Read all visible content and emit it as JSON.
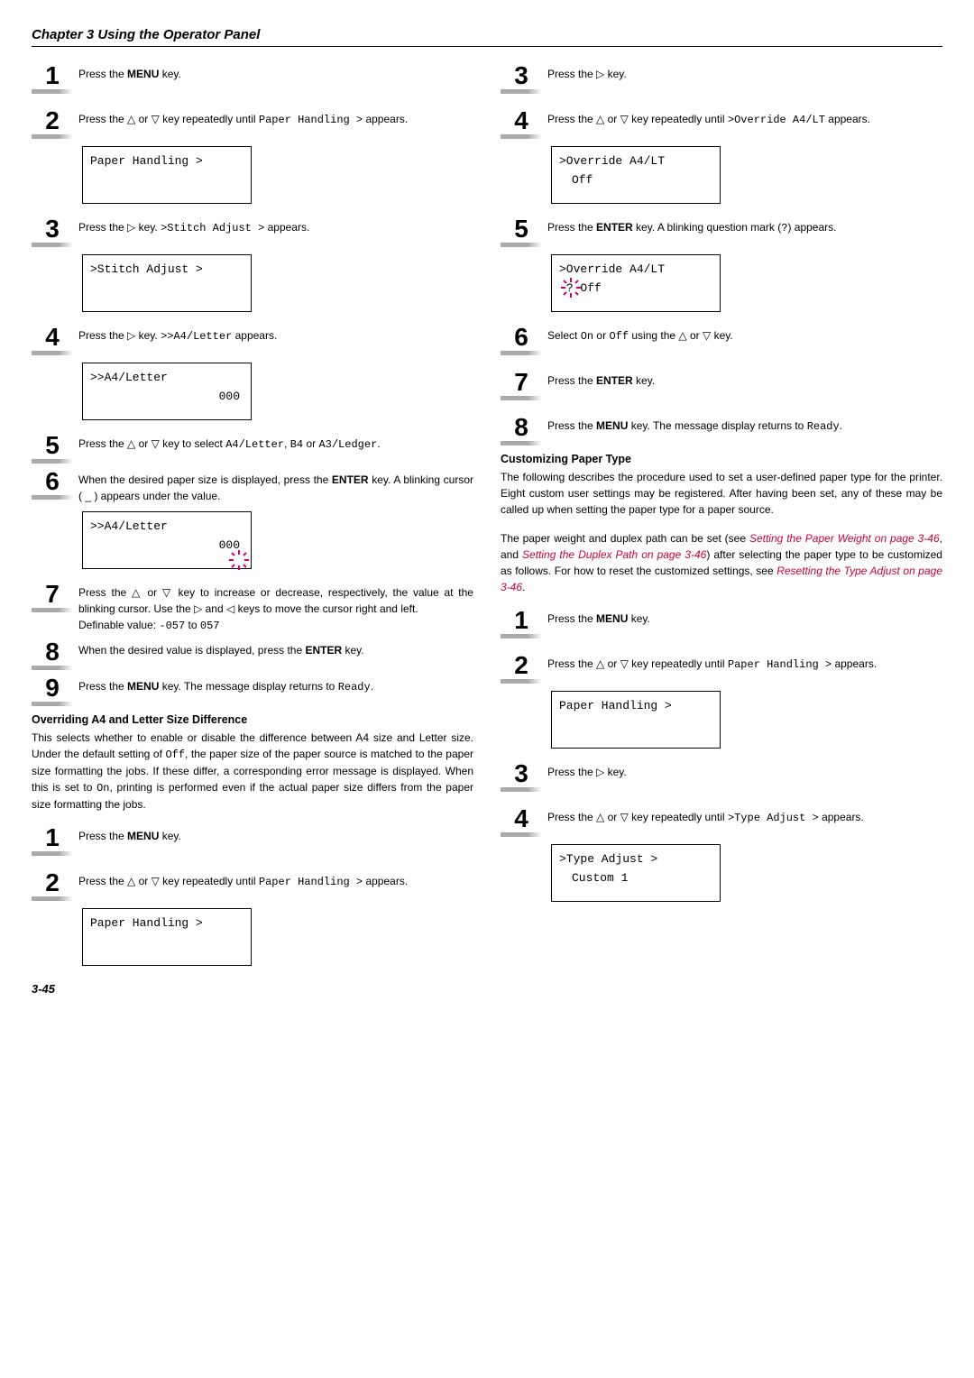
{
  "chapter": "Chapter 3  Using the Operator Panel",
  "pagenum": "3-45",
  "left": {
    "s1": {
      "a": "Press the ",
      "b": "MENU",
      "c": " key."
    },
    "s2": {
      "a": "Press the ",
      "b": " or ",
      "c": " key repeatedly until ",
      "mono": "Paper Handling >",
      "d": " appears."
    },
    "lcd2": "Paper Handling >",
    "s3": {
      "a": "Press the ",
      "b": " key. ",
      "mono": ">Stitch Adjust >",
      "c": " appears."
    },
    "lcd3": ">Stitch Adjust >",
    "s4": {
      "a": "Press the ",
      "b": " key. ",
      "mono": ">>A4/Letter",
      "c": " appears."
    },
    "lcd4_l1": ">>A4/Letter",
    "lcd4_l2": "000",
    "s5": {
      "a": "Press the ",
      "b": " or ",
      "c": " key to select ",
      "m1": "A4/Letter",
      "d": ", ",
      "m2": "B4",
      "e": " or ",
      "m3": "A3/Ledger",
      "f": "."
    },
    "s6": {
      "a": "When the desired paper size is displayed, press the ",
      "b": "ENTER",
      "c": " key. A blinking cursor ( _ ) appears under the value."
    },
    "lcd6_l1": ">>A4/Letter",
    "lcd6_l2": "000",
    "s7": {
      "a": "Press the ",
      "b": " or ",
      "c": " key to increase or decrease, respectively, the value at the blinking cursor. Use the ",
      "d": " and ",
      "e": " keys to move the cursor right and left.",
      "def": "Definable value: ",
      "defm": "-057",
      "to": " to ",
      "defm2": "057"
    },
    "s8": {
      "a": "When the desired value is displayed, press the ",
      "b": "ENTER",
      "c": " key."
    },
    "s9": {
      "a": "Press the ",
      "b": "MENU",
      "c": " key. The message display returns to ",
      "m": "Ready",
      "d": "."
    },
    "override_h": "Overriding A4 and Letter Size Difference",
    "override_p": {
      "a": "This selects whether to enable or disable the difference between A4 size and Letter size. Under the default setting of ",
      "m1": "Off",
      "b": ", the paper size of the paper source is matched to the paper size formatting the jobs. If these differ, a corresponding error message is displayed. When this is set to ",
      "m2": "On",
      "c": ", printing is performed even if the actual paper size differs from the paper size formatting the jobs."
    },
    "o1": {
      "a": "Press the ",
      "b": "MENU",
      "c": " key."
    },
    "o2": {
      "a": "Press the ",
      "b": " or ",
      "c": " key repeatedly until ",
      "mono": "Paper Handling >",
      "d": " appears."
    },
    "lcdO2": "Paper Handling >"
  },
  "right": {
    "s3": {
      "a": "Press the ",
      "b": " key."
    },
    "s4": {
      "a": "Press the ",
      "b": " or ",
      "c": " key repeatedly until ",
      "mono": ">Override A4/LT",
      "d": " appears."
    },
    "lcd4_l1": ">Override A4/LT",
    "lcd4_l2": "Off",
    "s5": {
      "a": "Press the ",
      "b": "ENTER",
      "c": " key. A blinking question mark (",
      "m": "?",
      "d": ") appears."
    },
    "lcd5_l1": ">Override A4/LT",
    "lcd5_l2": "? Off",
    "s6": {
      "a": "Select ",
      "m1": "On",
      "b": " or ",
      "m2": "Off",
      "c": " using the ",
      "d": " or ",
      "e": " key."
    },
    "s7": {
      "a": "Press the ",
      "b": "ENTER",
      "c": " key."
    },
    "s8": {
      "a": "Press the ",
      "b": "MENU",
      "c": " key. The message display returns to ",
      "m": "Ready",
      "d": "."
    },
    "custom_h": "Customizing Paper Type",
    "custom_p1": "The following describes the procedure used to set a user-defined paper type for the printer. Eight custom user settings may be registered. After having been set, any of these may be called up when setting the paper type for a paper source.",
    "custom_p2a": "The paper weight and duplex path can be set (see ",
    "link1": "Setting the Paper Weight on page 3-46",
    "custom_p2b": ", and ",
    "link2": "Setting the Duplex Path on page 3-46",
    "custom_p2c": ") after selecting the paper type to be customized as follows. For how to reset the customized settings, see ",
    "link3": "Resetting the Type Adjust on page 3-46",
    "custom_p2d": ".",
    "c1": {
      "a": "Press the ",
      "b": "MENU",
      "c": " key."
    },
    "c2": {
      "a": "Press the ",
      "b": " or ",
      "c": " key repeatedly until ",
      "mono": "Paper Handling >",
      "d": " appears."
    },
    "lcdC2": "Paper Handling >",
    "c3": {
      "a": "Press the ",
      "b": " key."
    },
    "c4": {
      "a": "Press the ",
      "b": " or ",
      "c": " key repeatedly until ",
      "mono": ">Type Adjust >",
      "d": " appears."
    },
    "lcdC4_l1": ">Type Adjust   >",
    "lcdC4_l2": "Custom 1"
  }
}
